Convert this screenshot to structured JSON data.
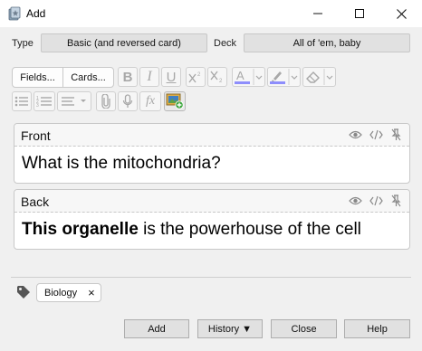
{
  "window": {
    "title": "Add"
  },
  "type": {
    "label": "Type",
    "value": "Basic (and reversed card)"
  },
  "deck": {
    "label": "Deck",
    "value": "All of 'em, baby"
  },
  "toolbar": {
    "fields_label": "Fields...",
    "cards_label": "Cards...",
    "function_label": "fx",
    "underline_color": "#8e8efc",
    "highlight_color": "#8e8efc"
  },
  "fields": [
    {
      "name": "Front",
      "content": "What is the mitochondria?"
    },
    {
      "name": "Back",
      "content_bold": "This organelle",
      "content_rest": " is the powerhouse of the cell"
    }
  ],
  "tags": [
    {
      "label": "Biology",
      "remove_glyph": "×"
    }
  ],
  "buttons": {
    "add": "Add",
    "history": "History ▼",
    "close": "Close",
    "help": "Help"
  },
  "icons": [
    "anki-icon",
    "minimize-icon",
    "maximize-icon",
    "close-icon",
    "bold-icon",
    "italic-icon",
    "underline-icon",
    "superscript-icon",
    "subscript-icon",
    "text-color-icon",
    "highlight-icon",
    "eraser-icon",
    "unordered-list-icon",
    "ordered-list-icon",
    "align-icon",
    "paperclip-icon",
    "microphone-icon",
    "function-icon",
    "image-occlusion-icon",
    "eye-icon",
    "html-editor-icon",
    "pin-icon",
    "tag-icon"
  ]
}
